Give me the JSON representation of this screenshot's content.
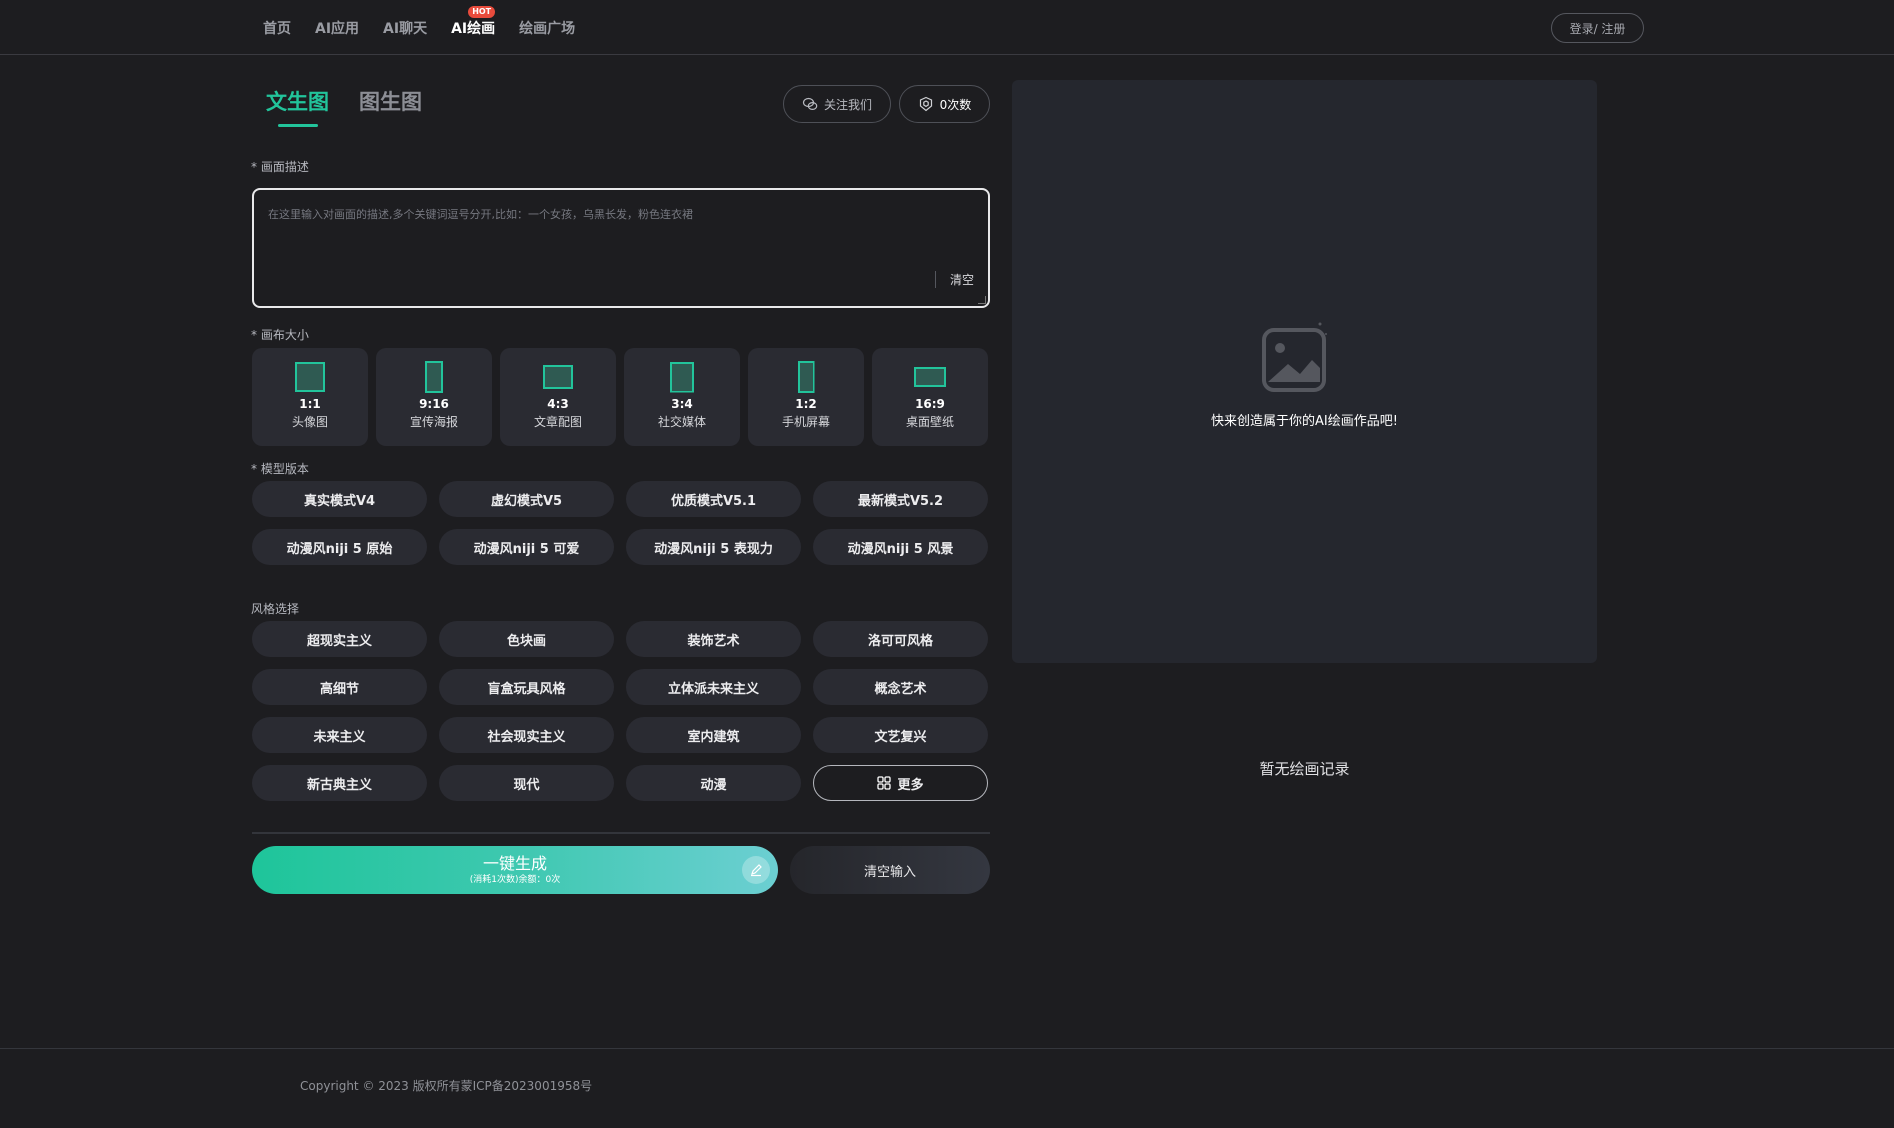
{
  "nav": {
    "items": [
      {
        "label": "首页"
      },
      {
        "label": "AI应用"
      },
      {
        "label": "AI聊天"
      },
      {
        "label": "AI绘画",
        "badge": "HOT"
      },
      {
        "label": "绘画广场"
      }
    ],
    "login_label": "登录/ 注册"
  },
  "tabs": [
    {
      "label": "文生图"
    },
    {
      "label": "图生图"
    }
  ],
  "follow_label": "关注我们",
  "count_label": "0次数",
  "prompt": {
    "label": "* 画面描述",
    "placeholder": "在这里输入对画面的描述,多个关键词逗号分开,比如：一个女孩，乌黑长发，粉色连衣裙",
    "value": "",
    "clear_label": "清空"
  },
  "canvas": {
    "label": "* 画布大小",
    "ratios": [
      {
        "value": "1:1",
        "name": "头像图"
      },
      {
        "value": "9:16",
        "name": "宣传海报"
      },
      {
        "value": "4:3",
        "name": "文章配图"
      },
      {
        "value": "3:4",
        "name": "社交媒体"
      },
      {
        "value": "1:2",
        "name": "手机屏幕"
      },
      {
        "value": "16:9",
        "name": "桌面壁纸"
      }
    ]
  },
  "model": {
    "label": "* 模型版本",
    "options": [
      "真实模式V4",
      "虚幻模式V5",
      "优质模式V5.1",
      "最新模式V5.2",
      "动漫风niji 5 原始",
      "动漫风niji 5 可爱",
      "动漫风niji 5 表现力",
      "动漫风niji 5 风景"
    ]
  },
  "style": {
    "label": "风格选择",
    "options": [
      "超现实主义",
      "色块画",
      "装饰艺术",
      "洛可可风格",
      "高细节",
      "盲盒玩具风格",
      "立体派未来主义",
      "概念艺术",
      "未来主义",
      "社会现实主义",
      "室内建筑",
      "文艺复兴",
      "新古典主义",
      "现代",
      "动漫"
    ],
    "more_label": "更多"
  },
  "generate": {
    "label": "一键生成",
    "sub": "(消耗1次数)余额：0次"
  },
  "clear_input_label": "清空输入",
  "preview": {
    "hint": "快来创造属于你的AI绘画作品吧!"
  },
  "no_record": "暂无绘画记录",
  "footer": {
    "copyright": "Copyright © 2023 版权所有蒙ICP备2023001958号"
  },
  "colors": {
    "accent": "#22c49b",
    "background": "#1d1d20",
    "card": "#2a2b32",
    "hot": "#e84b3c"
  }
}
